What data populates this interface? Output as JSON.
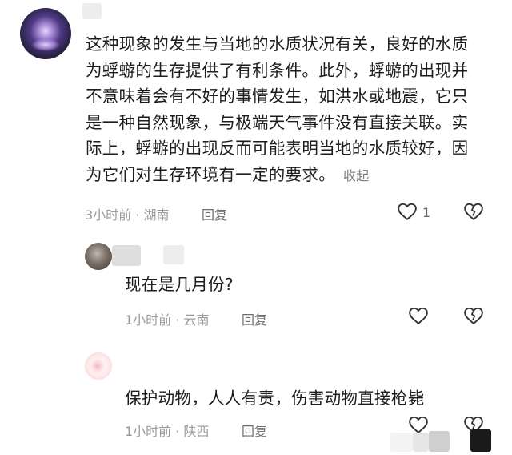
{
  "comment1": {
    "text": "这种现象的发生与当地的水质状况有关，良好的水质\n为蜉蝣的生存提供了有利条件。此外，蜉蝣的出现并\n不意味着会有不好的事情发生，如洪水或地震，它只\n是一种自然现象，与极端天气事件没有直接关联。实\n际上，蜉蝣的出现反而可能表明当地的水质较好，因\n为它们对生存环境有一定的要求。",
    "collapse_label": "收起",
    "meta": "3小时前 · 湖南",
    "reply_label": "回复",
    "like_count": "1"
  },
  "comment2": {
    "text": "现在是几月份?",
    "meta": "1小时前 · 云南",
    "reply_label": "回复"
  },
  "comment3": {
    "text": "保护动物，人人有责，伤害动物直接枪毙",
    "meta": "1小时前 · 陕西",
    "reply_label": "回复"
  },
  "icons": {
    "like": "heart-outline-icon",
    "dislike": "broken-heart-icon"
  }
}
